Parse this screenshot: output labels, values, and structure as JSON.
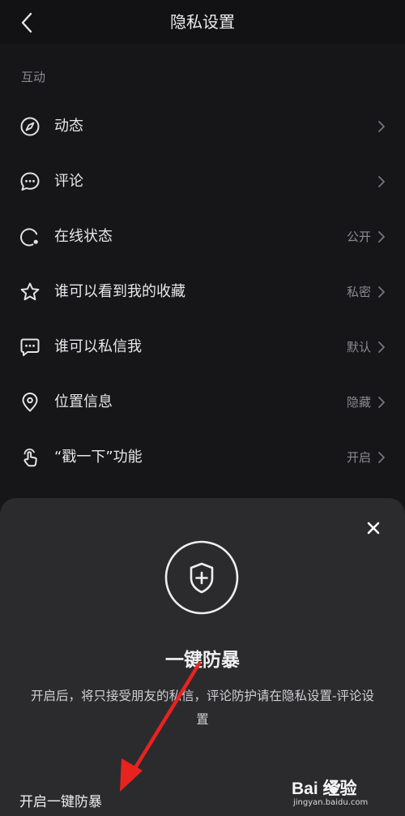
{
  "header": {
    "title": "隐私设置"
  },
  "section": {
    "label": "互动"
  },
  "settings": [
    {
      "label": "动态",
      "value": ""
    },
    {
      "label": "评论",
      "value": ""
    },
    {
      "label": "在线状态",
      "value": "公开"
    },
    {
      "label": "谁可以看到我的收藏",
      "value": "私密"
    },
    {
      "label": "谁可以私信我",
      "value": "默认"
    },
    {
      "label": "位置信息",
      "value": "隐藏"
    },
    {
      "label": "“戳一下”功能",
      "value": "开启"
    }
  ],
  "sheet": {
    "title": "一键防暴",
    "description": "开启后，将只接受朋友的私信，评论防护请在隐私设置-评论设置",
    "action_label": "开启一键防暴"
  },
  "watermark": {
    "brand": "Bai  经验",
    "url": "jingyan.baidu.com"
  },
  "colors": {
    "background": "#161619",
    "sheet": "#2b2b2e",
    "arrow": "#e8231f"
  }
}
